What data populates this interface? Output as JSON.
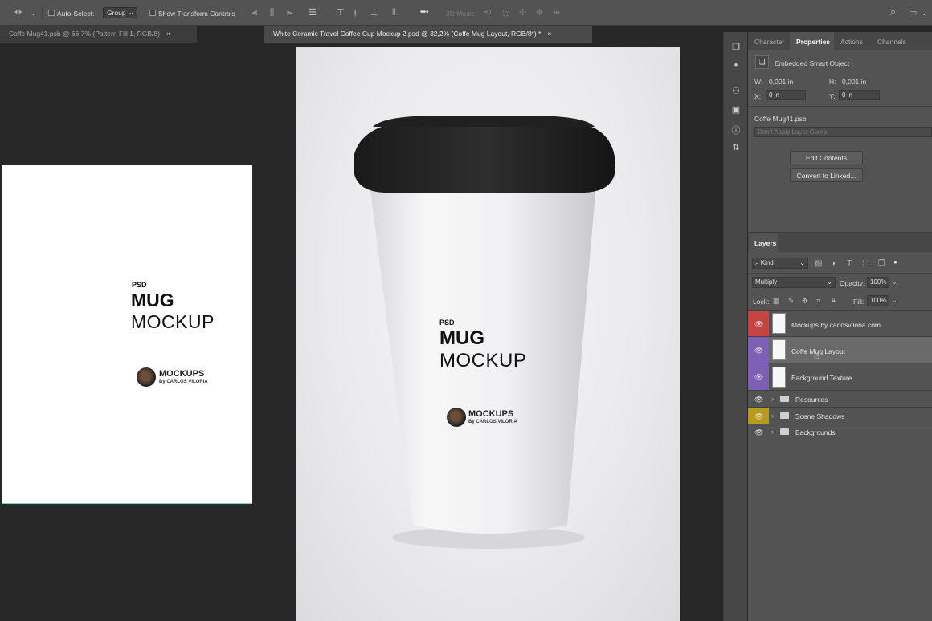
{
  "options_bar": {
    "auto_select_label": "Auto-Select:",
    "auto_select_value": "Group",
    "show_transform_label": "Show Transform Controls",
    "mode_3d_label": "3D Mode:",
    "more_label": "•••"
  },
  "tabs": [
    {
      "label": "Coffe Mug41.psb @ 66,7% (Pattern Fill 1, RGB/8)",
      "close": "×"
    },
    {
      "label": "White Ceramic Travel Coffee Cup Mockup 2.psd @ 32,2% (Coffe Mug Layout, RGB/8*) *",
      "close": "×"
    }
  ],
  "artboard": {
    "psd": "PSD",
    "mug": "MUG",
    "mockup": "MOCKUP",
    "logo_title": "MOCKUPS",
    "logo_sub": "By CARLOS VILORIA"
  },
  "cup": {
    "psd": "PSD",
    "mug": "MUG",
    "mockup": "MOCKUP",
    "logo_title": "MOCKUPS",
    "logo_sub": "By CARLOS VILORIA"
  },
  "properties": {
    "tabs": [
      "Character",
      "Properties",
      "Actions",
      "Channels"
    ],
    "object_type": "Embedded Smart Object",
    "w_label": "W:",
    "w_value": "0,001 in",
    "h_label": "H:",
    "h_value": "0,001 in",
    "x_label": "X:",
    "x_value": "0 in",
    "y_label": "Y:",
    "y_value": "0 in",
    "file_name": "Coffe Mug41.psb",
    "layer_comp": "Don't Apply Layer Comp",
    "edit_contents": "Edit Contents",
    "convert_linked": "Convert to Linked..."
  },
  "layers": {
    "tab": "Layers",
    "filter_kind": "Kind",
    "blend_mode": "Multiply",
    "opacity_label": "Opacity:",
    "opacity_value": "100%",
    "lock_label": "Lock:",
    "fill_label": "Fill:",
    "fill_value": "100%",
    "items": [
      {
        "name": "Mockups by carlosviloria.com",
        "color": "#c64444"
      },
      {
        "name": "Coffe Mug Layout",
        "color": "#7d5fb3"
      },
      {
        "name": "Background Texture",
        "color": "#7d5fb3"
      },
      {
        "name": "Resources",
        "color": ""
      },
      {
        "name": "Scene Shadows",
        "color": "#b89a1e"
      },
      {
        "name": "Backgrounds",
        "color": ""
      }
    ]
  }
}
